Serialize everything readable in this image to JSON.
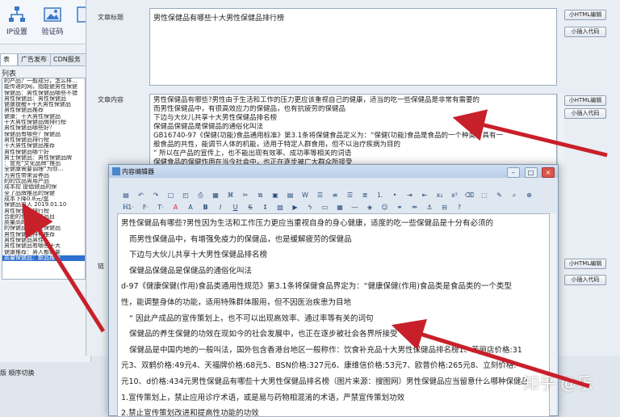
{
  "toolbar": {
    "items": [
      {
        "label": "IP设置",
        "icon": "network-icon"
      },
      {
        "label": "验证码",
        "icon": "image-icon"
      }
    ]
  },
  "tabs": [
    "表",
    "广告发布",
    "CDN服务"
  ],
  "list": {
    "label": "列表",
    "items": [
      "的产品？一般成分，怎么样…",
      "能传递的网，指能健男性保健",
      "保健品：男性保健品哪些不错",
      "男性保健品：男性保健品",
      "健康提醒+十大男性保健品",
      "男性保健品推荐",
      "健康：十大男性保健品",
      "十大男性保健品牌排行榜",
      "男性保健品哪些好？",
      "保健品有哪些？保健品",
      "男性保健品排行榜",
      "十大男性保健品推荐",
      "男性保健品哪个好",
      "男士保健品：男性保健品牌",
      "：宣充“文化品牌”推出",
      "全健康需要调理”为你…",
      "为男性带来营养品",
      "的的饮品男用产品",
      "成本控 提倡健品的保",
      "全了品牌推出的保健",
      "成本下降0.8元/盒",
      "保健品男人  2019.01.10",
      "男性保健品排行榜",
      "合肥的保健品产品目",
      "质量高的保健品",
      "的保健品：男性保健品",
      "男性保健品排行推荐",
      "男性保健品男性",
      "男性保健品有哪些十大",
      "健康推荐：男人都需要",
      "质量保健品：新品推荐"
    ],
    "selected": [
      30
    ]
  },
  "form": {
    "title_label": "文章标题",
    "title_value": "男性保健品有哪些十大男性保健品排行榜",
    "content_label": "文章内容",
    "content_lines": [
      "男性保健品有哪些?男性由于生活和工作的压力更应该重视自己的健康，适当的吃一些保健品是非常有需要的",
      "而男性保健品中，有很高效应力的保健品，也有抗疲劳的保健品",
      "下边与大伙儿共享十大男性保健品排名榜",
      "保健品保健品是保健品的通俗化叫法",
      "GB16740-97《保健(功能)食品通用标准》第3.1条将保健食品定义为：“保健(功能)食品是食品的一个种类，具有一",
      "般食品的共性，能调节人体的机能，适用于特定人群食用，但不以治疗疾病为目的",
      "“ 所以在产品的宣传上，也不能出现有效率、成功率等相关的词语",
      "保健食品的保健作用在当今社会中，也正在逐步被广大群众所接受",
      "保健品是中国内地的一般叫法，国外包含香港台地区一般称作：饮食补充品十大男性保健品排名榜1，茶..."
    ],
    "buttons": {
      "html_edit": "小HTML编辑",
      "insert_code": "小插入代码"
    },
    "other_label": "链"
  },
  "editor": {
    "title": "内容编辑器",
    "paragraphs": [
      "男性保健品有哪些?男性因为生活和工作压力更应当重视自身的身心健康，适度的吃一些保健品是十分有必须的",
      "而男性保健品中，有增强免疫力的保健品，也是缓解疲劳的保健品",
      "下边与大伙儿共享十大男性保健品排名榜",
      "保健品保健品是保健品的通俗化叫法",
      "d-97《健康保健(作用)食品类通用性规范》第3.1条将保健食品界定为：“健康保健(作用)食品类是食品类的一个类型",
      "性，能调整身体的功能，适用特殊群体服用，但不因医治疾患为目地",
      "“ 因此产成品的宣传策划上，也不可以出现高效率、通过率等有关的词句",
      "保健品的养生保健的功效在现如今的社会发展中，也正在逐步被社会各界所接受",
      "保健品是中国内地的一般叫法，国外包含香港台地区一般称作：饮食补充品十大男性保健品排名榜1、茉丽店价格:31",
      "元3、双鹤价格:49元4、天福牌价格:68元5、BSN价格:327元6、康维信价格:53元7、欧普价格:265元8、立刻价格:",
      "元10、d价格:434元男性保健品有哪些十大男性保健品排名榜（图片来源：搜图网）男性保健品应当留意什么哪种保健品",
      "1.宣传策划上，禁止应用诊疗术语，或是易与药物相混淆的术语，严禁宣传策划功效",
      "2.禁止宣传策划改进和提高性功能的功效",
      "3.广告词上须附带显著统一的浅蓝色保健食品标志，在其中书报刊印物广告词中的保健食品标志，其直径不可低"
    ]
  },
  "bottom": {
    "left_text": "版  顺序切换",
    "watermark": "知乎 @乐"
  },
  "colors": {
    "arrow": "#c8202a",
    "selection": "#2f6fd0"
  }
}
